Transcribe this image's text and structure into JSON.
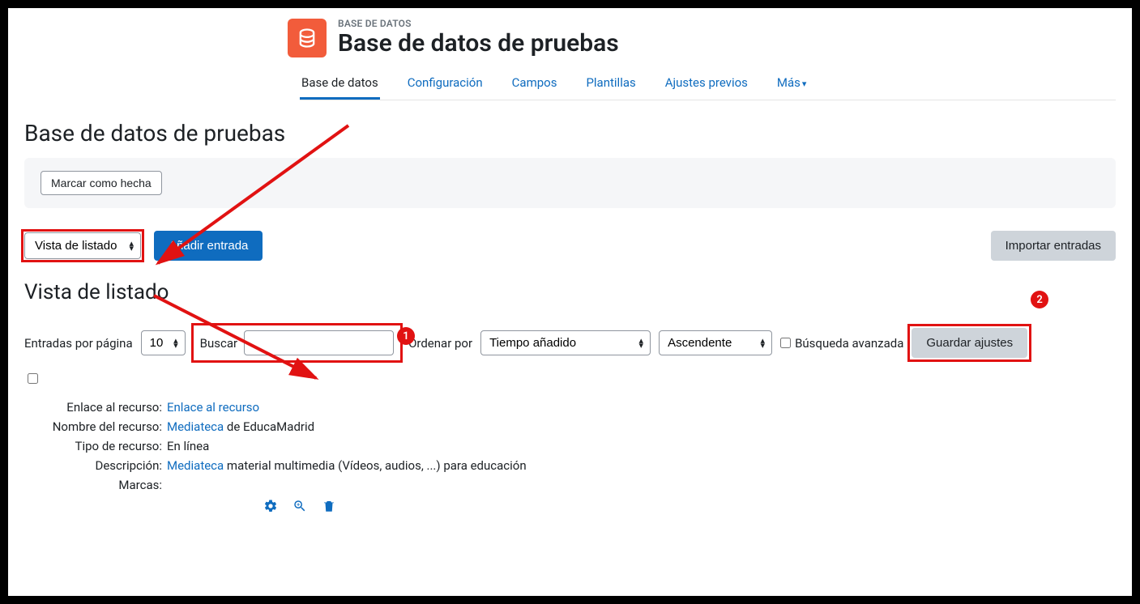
{
  "header": {
    "eyebrow": "BASE DE DATOS",
    "title": "Base de datos de pruebas"
  },
  "tabs": {
    "items": [
      {
        "label": "Base de datos",
        "active": true
      },
      {
        "label": "Configuración",
        "active": false
      },
      {
        "label": "Campos",
        "active": false
      },
      {
        "label": "Plantillas",
        "active": false
      },
      {
        "label": "Ajustes previos",
        "active": false
      },
      {
        "label": "Más",
        "active": false,
        "has_chevron": true
      }
    ]
  },
  "page_heading": "Base de datos de pruebas",
  "banner": {
    "mark_done": "Marcar como hecha"
  },
  "toolbar": {
    "view_select": "Vista de listado",
    "add_entry": "Añadir entrada",
    "import_entries": "Importar entradas"
  },
  "sub_heading": "Vista de listado",
  "filters": {
    "entries_per_page_label": "Entradas por página",
    "entries_per_page_value": "10",
    "search_label": "Buscar",
    "search_value": "",
    "sort_label": "Ordenar por",
    "sort_value": "Tiempo añadido",
    "order_value": "Ascendente",
    "advanced_search_label": "Búsqueda avanzada",
    "save_settings": "Guardar ajustes"
  },
  "badges": {
    "b1": "1",
    "b2": "2"
  },
  "entry": {
    "fields": {
      "link_label": "Enlace al recurso:",
      "link_value": "Enlace al recurso",
      "name_label": "Nombre del recurso:",
      "name_link": "Mediateca",
      "name_rest": " de EducaMadrid",
      "type_label": "Tipo de recurso:",
      "type_value": "En línea",
      "desc_label": "Descripción:",
      "desc_link": "Mediateca",
      "desc_rest": " material multimedia (Vídeos, audios, ...) para educación",
      "tags_label": "Marcas:"
    }
  }
}
